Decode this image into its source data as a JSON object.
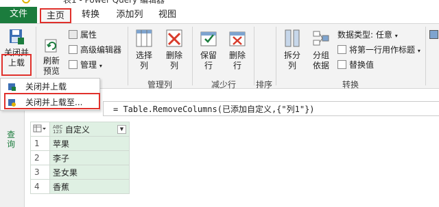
{
  "window": {
    "title": "表1 - Power Query 编辑器"
  },
  "tabs": [
    "文件",
    "主页",
    "转换",
    "添加列",
    "视图"
  ],
  "ribbon": {
    "close_load": "关闭并\n上载",
    "refresh": "刷新\n预览",
    "properties": "属性",
    "advanced_editor": "高级编辑器",
    "manage": "管理",
    "choose_columns": "选择\n列",
    "remove_columns": "删除\n列",
    "group_manage_columns": "管理列",
    "keep_rows": "保留\n行",
    "remove_rows": "删除\n行",
    "group_reduce_rows": "减少行",
    "group_sort": "排序",
    "split_column": "拆分\n列",
    "group_by": "分组\n依据",
    "data_type": "数据类型: 任意",
    "first_row_header": "将第一行用作标题",
    "replace_values": "替换值",
    "group_transform": "转换"
  },
  "dropdown": {
    "items": [
      "关闭并上载",
      "关闭并上载至..."
    ]
  },
  "left_pane": {
    "label": "查询"
  },
  "formula": {
    "text": "= Table.RemoveColumns(已添加自定义,{\"列1\"})"
  },
  "table": {
    "header": "自定义",
    "type_badge": "ABC\n123",
    "rows": [
      {
        "n": "1",
        "v": "苹果"
      },
      {
        "n": "2",
        "v": "李子"
      },
      {
        "n": "3",
        "v": "圣女果"
      },
      {
        "n": "4",
        "v": "香蕉"
      }
    ]
  },
  "colors": {
    "accent": "#1b7c3d",
    "highlight": "#e0302b",
    "cell_fill": "#dff0e3"
  }
}
